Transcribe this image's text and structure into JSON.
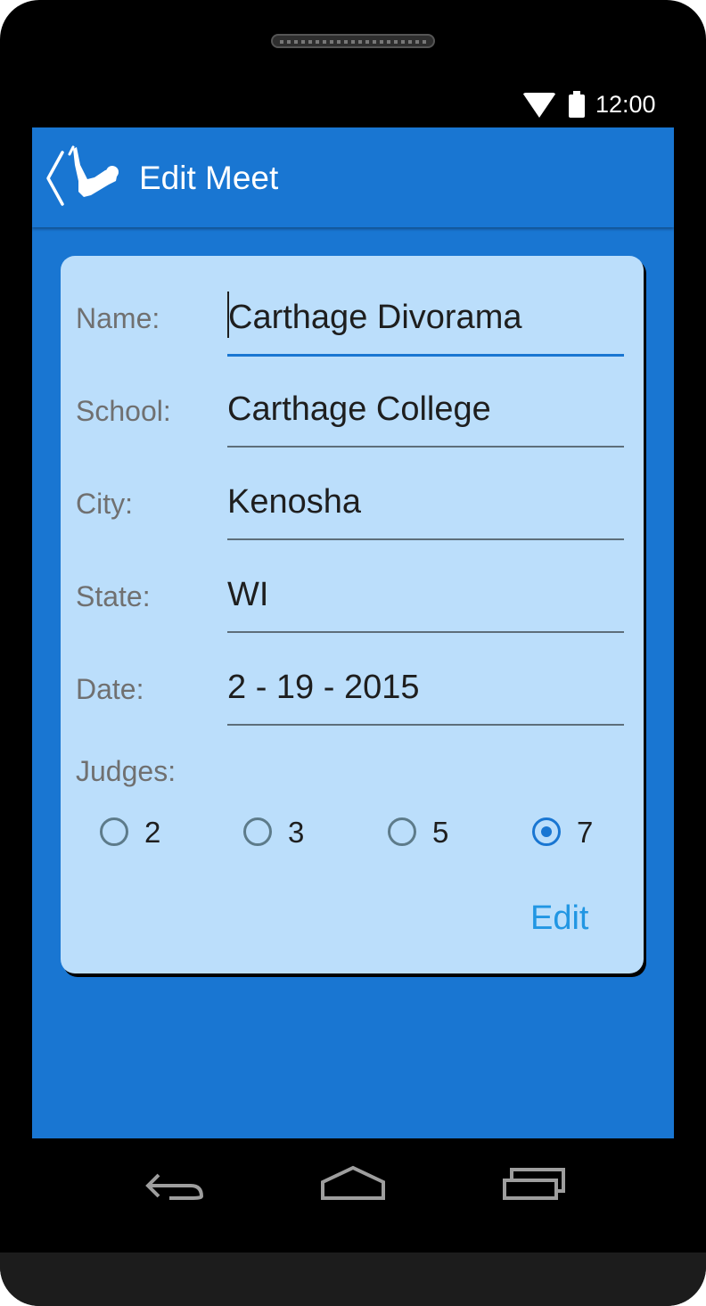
{
  "status_bar": {
    "time": "12:00",
    "wifi_icon": "wifi-icon",
    "battery_icon": "battery-icon"
  },
  "app_bar": {
    "title": "Edit Meet",
    "back_icon": "back-chevron-icon",
    "logo_icon": "diver-logo-icon"
  },
  "form": {
    "fields": [
      {
        "label": "Name:",
        "value": "Carthage Divorama",
        "focused": true
      },
      {
        "label": "School:",
        "value": "Carthage College",
        "focused": false
      },
      {
        "label": "City:",
        "value": "Kenosha",
        "focused": false
      },
      {
        "label": "State:",
        "value": "WI",
        "focused": false
      },
      {
        "label": "Date:",
        "value": "2 - 19 - 2015",
        "focused": false
      }
    ],
    "judges_label": "Judges:",
    "judges_options": [
      {
        "label": "2",
        "checked": false
      },
      {
        "label": "3",
        "checked": false
      },
      {
        "label": "5",
        "checked": false
      },
      {
        "label": "7",
        "checked": true
      }
    ],
    "edit_label": "Edit"
  },
  "nav_bar": {
    "back_icon": "nav-back-icon",
    "home_icon": "nav-home-icon",
    "recents_icon": "nav-recents-icon"
  },
  "colors": {
    "primary": "#1976d2",
    "card": "#bbdefb",
    "accent_text": "#2196e3"
  }
}
